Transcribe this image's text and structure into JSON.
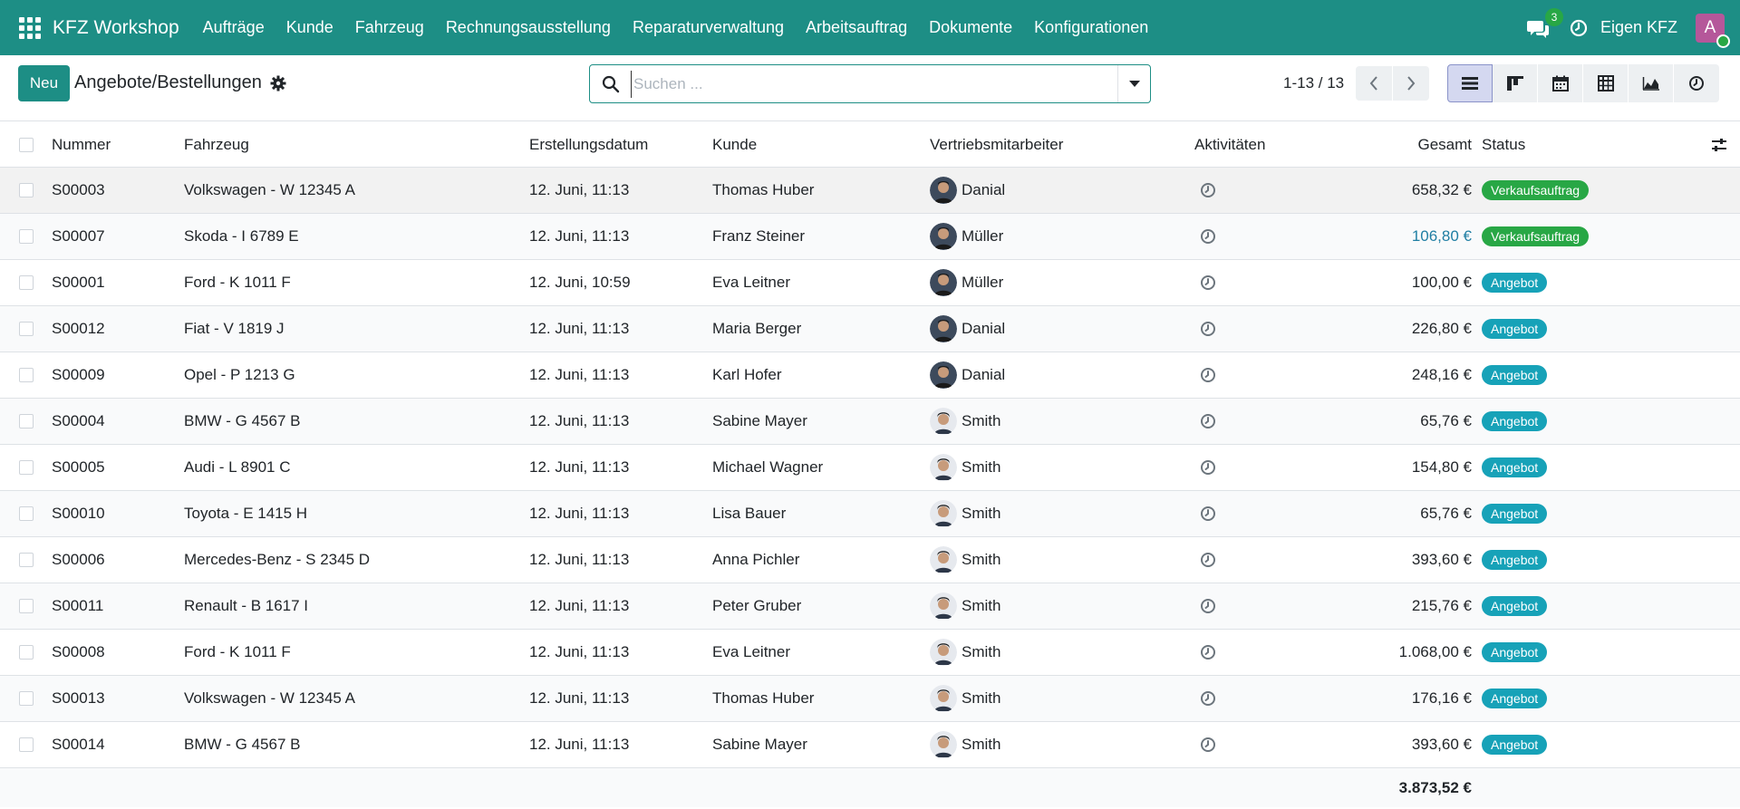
{
  "navbar": {
    "app_name": "KFZ Workshop",
    "menu": [
      "Aufträge",
      "Kunde",
      "Fahrzeug",
      "Rechnungsausstellung",
      "Reparaturverwaltung",
      "Arbeitsauftrag",
      "Dokumente",
      "Konfigurationen"
    ],
    "chat_count": "3",
    "company": "Eigen KFZ",
    "user_initial": "A",
    "colors": {
      "primary": "#1d8e85",
      "avatar": "#b5579a"
    }
  },
  "control": {
    "new_label": "Neu",
    "title": "Angebote/Bestellungen",
    "search_placeholder": "Suchen ...",
    "pager": "1-13 / 13"
  },
  "table": {
    "columns": {
      "number": "Nummer",
      "vehicle": "Fahrzeug",
      "date": "Erstellungsdatum",
      "customer": "Kunde",
      "salesperson": "Vertriebsmitarbeiter",
      "activities": "Aktivitäten",
      "total": "Gesamt",
      "status": "Status"
    },
    "rows": [
      {
        "number": "S00003",
        "vehicle": "Volkswagen - W 12345 A",
        "date": "12. Juni, 11:13",
        "customer": "Thomas Huber",
        "salesperson": "Danial",
        "total": "658,32 €",
        "status": "Verkaufsauftrag"
      },
      {
        "number": "S00007",
        "vehicle": "Skoda - I 6789 E",
        "date": "12. Juni, 11:13",
        "customer": "Franz Steiner",
        "salesperson": "Müller",
        "total": "106,80 €",
        "status": "Verkaufsauftrag"
      },
      {
        "number": "S00001",
        "vehicle": "Ford - K 1011 F",
        "date": "12. Juni, 10:59",
        "customer": "Eva Leitner",
        "salesperson": "Müller",
        "total": "100,00 €",
        "status": "Angebot"
      },
      {
        "number": "S00012",
        "vehicle": "Fiat - V 1819 J",
        "date": "12. Juni, 11:13",
        "customer": "Maria Berger",
        "salesperson": "Danial",
        "total": "226,80 €",
        "status": "Angebot"
      },
      {
        "number": "S00009",
        "vehicle": "Opel - P 1213 G",
        "date": "12. Juni, 11:13",
        "customer": "Karl Hofer",
        "salesperson": "Danial",
        "total": "248,16 €",
        "status": "Angebot"
      },
      {
        "number": "S00004",
        "vehicle": "BMW - G 4567 B",
        "date": "12. Juni, 11:13",
        "customer": "Sabine Mayer",
        "salesperson": "Smith",
        "total": "65,76 €",
        "status": "Angebot"
      },
      {
        "number": "S00005",
        "vehicle": "Audi - L 8901 C",
        "date": "12. Juni, 11:13",
        "customer": "Michael Wagner",
        "salesperson": "Smith",
        "total": "154,80 €",
        "status": "Angebot"
      },
      {
        "number": "S00010",
        "vehicle": "Toyota - E 1415 H",
        "date": "12. Juni, 11:13",
        "customer": "Lisa Bauer",
        "salesperson": "Smith",
        "total": "65,76 €",
        "status": "Angebot"
      },
      {
        "number": "S00006",
        "vehicle": "Mercedes-Benz - S 2345 D",
        "date": "12. Juni, 11:13",
        "customer": "Anna Pichler",
        "salesperson": "Smith",
        "total": "393,60 €",
        "status": "Angebot"
      },
      {
        "number": "S00011",
        "vehicle": "Renault - B 1617 I",
        "date": "12. Juni, 11:13",
        "customer": "Peter Gruber",
        "salesperson": "Smith",
        "total": "215,76 €",
        "status": "Angebot"
      },
      {
        "number": "S00008",
        "vehicle": "Ford - K 1011 F",
        "date": "12. Juni, 11:13",
        "customer": "Eva Leitner",
        "salesperson": "Smith",
        "total": "1.068,00 €",
        "status": "Angebot"
      },
      {
        "number": "S00013",
        "vehicle": "Volkswagen - W 12345 A",
        "date": "12. Juni, 11:13",
        "customer": "Thomas Huber",
        "salesperson": "Smith",
        "total": "176,16 €",
        "status": "Angebot"
      },
      {
        "number": "S00014",
        "vehicle": "BMW - G 4567 B",
        "date": "12. Juni, 11:13",
        "customer": "Sabine Mayer",
        "salesperson": "Smith",
        "total": "393,60 €",
        "status": "Angebot"
      }
    ],
    "sum_total": "3.873,52 €",
    "status_colors": {
      "Verkaufsauftrag": "#28a745",
      "Angebot": "#17a2b8"
    }
  }
}
